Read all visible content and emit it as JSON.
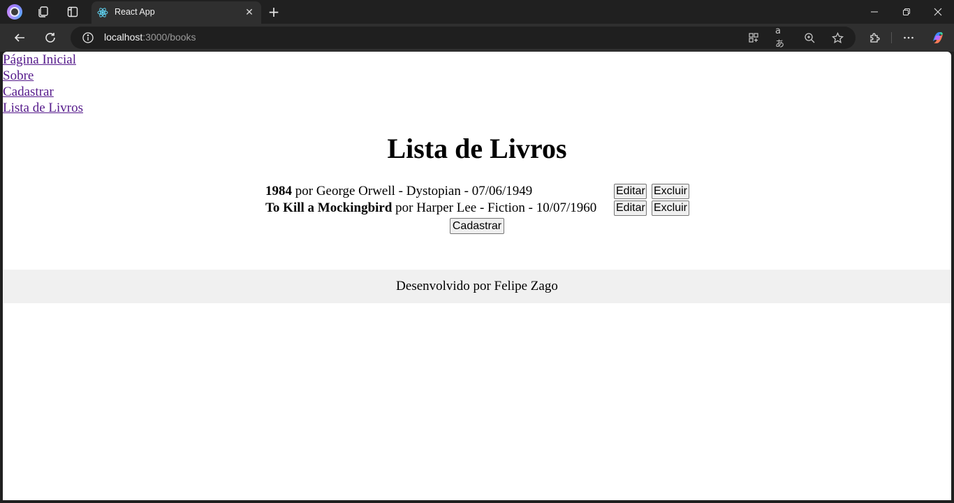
{
  "browser": {
    "tab_title": "React App",
    "url_host": "localhost",
    "url_path": ":3000/books"
  },
  "nav": {
    "links": [
      "Página Inicial",
      "Sobre",
      "Cadastrar",
      "Lista de Livros"
    ]
  },
  "page": {
    "title": "Lista de Livros",
    "books": [
      {
        "title": "1984",
        "author": "George Orwell",
        "genre": "Dystopian",
        "date": "07/06/1949"
      },
      {
        "title": "To Kill a Mockingbird",
        "author": "Harper Lee",
        "genre": "Fiction",
        "date": "10/07/1960"
      }
    ],
    "by_word": "por",
    "edit_label": "Editar",
    "delete_label": "Excluir",
    "register_label": "Cadastrar"
  },
  "footer": {
    "text": "Desenvolvido por Felipe Zago"
  },
  "colors": {
    "link": "#551a8b",
    "chrome_dark": "#202020",
    "chrome_toolbar": "#2f2f2f",
    "footer_bg": "#f0f0f0"
  }
}
